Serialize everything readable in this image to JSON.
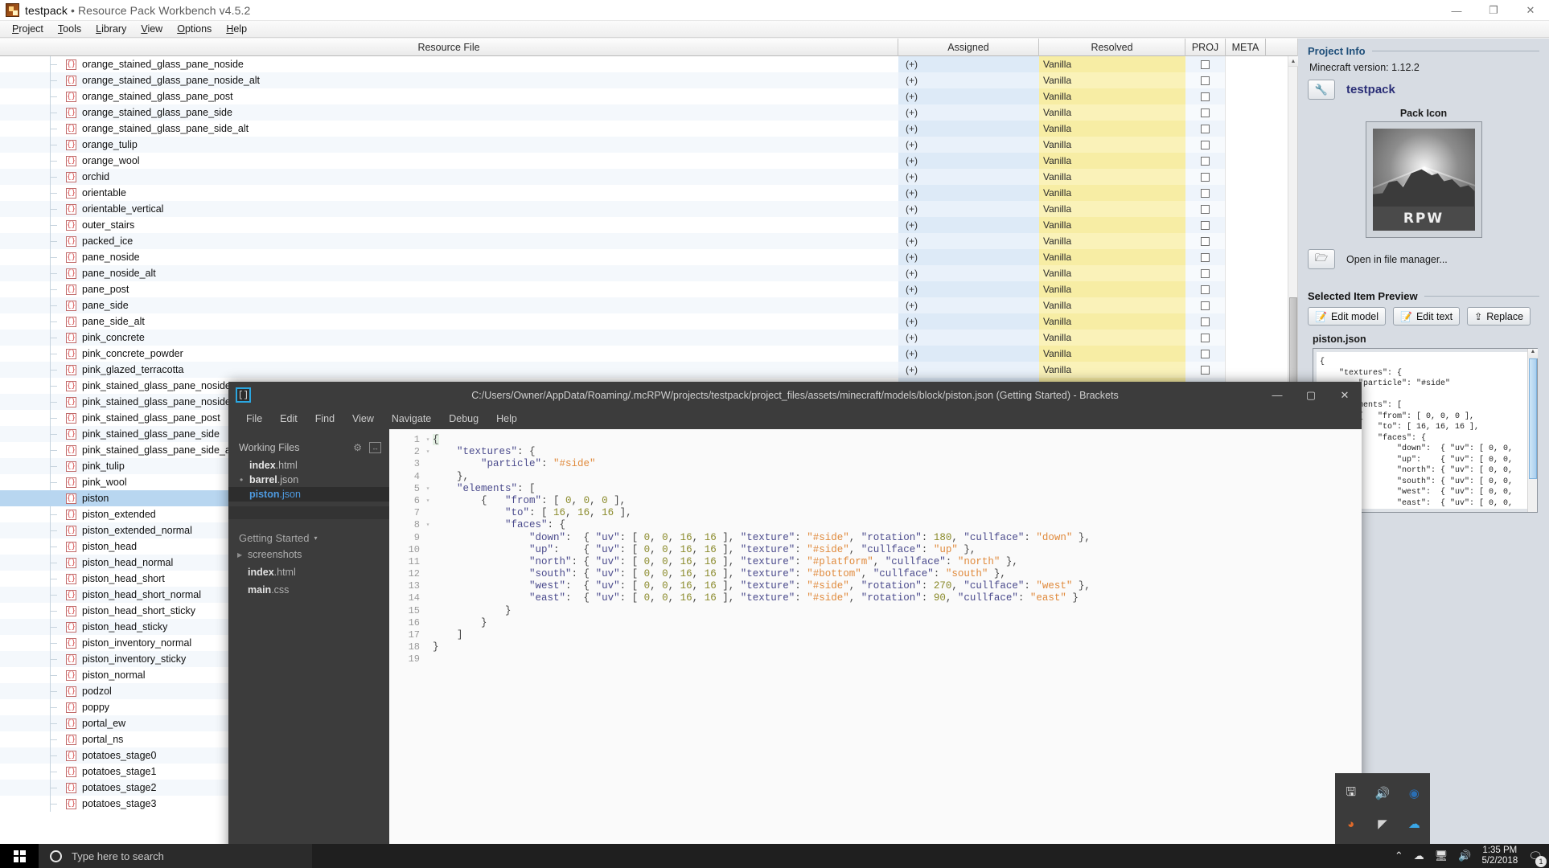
{
  "window": {
    "app_title_project": "testpack",
    "app_title_sep": "•",
    "app_title_app": "Resource Pack Workbench v4.5.2",
    "minimize": "—",
    "maximize": "❐",
    "close": "✕",
    "app_icon": "rpw-app-icon"
  },
  "menubar": [
    {
      "label": "Project"
    },
    {
      "label": "Tools"
    },
    {
      "label": "Library"
    },
    {
      "label": "View"
    },
    {
      "label": "Options"
    },
    {
      "label": "Help"
    }
  ],
  "table": {
    "columns": [
      "Resource File",
      "Assigned",
      "Resolved",
      "PROJ",
      "META"
    ],
    "assigned_value": "(+)",
    "resolved_value": "Vanilla",
    "rows": [
      "orange_stained_glass_pane_noside",
      "orange_stained_glass_pane_noside_alt",
      "orange_stained_glass_pane_post",
      "orange_stained_glass_pane_side",
      "orange_stained_glass_pane_side_alt",
      "orange_tulip",
      "orange_wool",
      "orchid",
      "orientable",
      "orientable_vertical",
      "outer_stairs",
      "packed_ice",
      "pane_noside",
      "pane_noside_alt",
      "pane_post",
      "pane_side",
      "pane_side_alt",
      "pink_concrete",
      "pink_concrete_powder",
      "pink_glazed_terracotta",
      "pink_stained_glass_pane_noside",
      "pink_stained_glass_pane_noside_alt",
      "pink_stained_glass_pane_post",
      "pink_stained_glass_pane_side",
      "pink_stained_glass_pane_side_alt",
      "pink_tulip",
      "pink_wool",
      "piston",
      "piston_extended",
      "piston_extended_normal",
      "piston_head",
      "piston_head_normal",
      "piston_head_short",
      "piston_head_short_normal",
      "piston_head_short_sticky",
      "piston_head_sticky",
      "piston_inventory_normal",
      "piston_inventory_sticky",
      "piston_normal",
      "podzol",
      "poppy",
      "portal_ew",
      "portal_ns",
      "potatoes_stage0",
      "potatoes_stage1",
      "potatoes_stage2",
      "potatoes_stage3"
    ],
    "selected_row": "piston",
    "file_icon": "json-braces-icon"
  },
  "project_info": {
    "section_title": "Project Info",
    "minecraft_version": "Minecraft version: 1.12.2",
    "pack_name": "testpack",
    "edit_pack_icon": "wrench-icon",
    "pack_icon_label": "Pack Icon",
    "pack_icon_text": "RPW",
    "open_file_manager_icon": "folder-open-icon",
    "open_file_manager": "Open in file manager..."
  },
  "selected_item_preview": {
    "section_title": "Selected Item Preview",
    "buttons": [
      {
        "label": "Edit model",
        "icon": "pencil-note-icon"
      },
      {
        "label": "Edit text",
        "icon": "pencil-note-icon"
      },
      {
        "label": "Replace",
        "icon": "upload-icon"
      }
    ],
    "file_name": "piston.json",
    "preview_lines": [
      "{",
      "    \"textures\": {",
      "        \"particle\": \"#side\"",
      "    },",
      "    \"elements\": [",
      "        {   \"from\": [ 0, 0, 0 ],",
      "            \"to\": [ 16, 16, 16 ],",
      "            \"faces\": {",
      "                \"down\":  { \"uv\": [ 0, 0,",
      "                \"up\":    { \"uv\": [ 0, 0,",
      "                \"north\": { \"uv\": [ 0, 0,",
      "                \"south\": { \"uv\": [ 0, 0,",
      "                \"west\":  { \"uv\": [ 0, 0,",
      "                \"east\":  { \"uv\": [ 0, 0,"
    ]
  },
  "brackets": {
    "app_icon": "brackets-logo-icon",
    "title": "C:/Users/Owner/AppData/Roaming/.mcRPW/projects/testpack/project_files/assets/minecraft/models/block/piston.json (Getting Started) - Brackets",
    "minimize": "—",
    "maximize": "▢",
    "close": "✕",
    "menu": [
      "File",
      "Edit",
      "Find",
      "View",
      "Navigate",
      "Debug",
      "Help"
    ],
    "working_files_label": "Working Files",
    "gear_icon": "gear-icon",
    "split_icon": "split-view-icon",
    "working_files": [
      {
        "name": "index",
        "ext": ".html",
        "dirty": false,
        "active": false
      },
      {
        "name": "barrel",
        "ext": ".json",
        "dirty": true,
        "active": false
      },
      {
        "name": "piston",
        "ext": ".json",
        "dirty": false,
        "active": true
      }
    ],
    "project_label": "Getting Started",
    "project_caret": "▾",
    "tree": [
      {
        "name": "screenshots",
        "ext": "",
        "folder": true
      },
      {
        "name": "index",
        "ext": ".html",
        "folder": false
      },
      {
        "name": "main",
        "ext": ".css",
        "folder": false
      }
    ],
    "code_lines": [
      {
        "num": "1",
        "fold": "▾",
        "tokens": [
          {
            "t": "{",
            "c": "p"
          }
        ]
      },
      {
        "num": "2",
        "fold": "▾",
        "tokens": [
          {
            "t": "    ",
            "c": "p"
          },
          {
            "t": "\"textures\"",
            "c": "k"
          },
          {
            "t": ": {",
            "c": "p"
          }
        ]
      },
      {
        "num": "3",
        "fold": "",
        "tokens": [
          {
            "t": "        ",
            "c": "p"
          },
          {
            "t": "\"particle\"",
            "c": "k"
          },
          {
            "t": ": ",
            "c": "p"
          },
          {
            "t": "\"#side\"",
            "c": "s"
          }
        ]
      },
      {
        "num": "4",
        "fold": "",
        "tokens": [
          {
            "t": "    },",
            "c": "p"
          }
        ]
      },
      {
        "num": "5",
        "fold": "▾",
        "tokens": [
          {
            "t": "    ",
            "c": "p"
          },
          {
            "t": "\"elements\"",
            "c": "k"
          },
          {
            "t": ": [",
            "c": "p"
          }
        ]
      },
      {
        "num": "6",
        "fold": "▾",
        "tokens": [
          {
            "t": "        {   ",
            "c": "p"
          },
          {
            "t": "\"from\"",
            "c": "k"
          },
          {
            "t": ": [ ",
            "c": "p"
          },
          {
            "t": "0",
            "c": "n"
          },
          {
            "t": ", ",
            "c": "p"
          },
          {
            "t": "0",
            "c": "n"
          },
          {
            "t": ", ",
            "c": "p"
          },
          {
            "t": "0",
            "c": "n"
          },
          {
            "t": " ],",
            "c": "p"
          }
        ]
      },
      {
        "num": "7",
        "fold": "",
        "tokens": [
          {
            "t": "            ",
            "c": "p"
          },
          {
            "t": "\"to\"",
            "c": "k"
          },
          {
            "t": ": [ ",
            "c": "p"
          },
          {
            "t": "16",
            "c": "n"
          },
          {
            "t": ", ",
            "c": "p"
          },
          {
            "t": "16",
            "c": "n"
          },
          {
            "t": ", ",
            "c": "p"
          },
          {
            "t": "16",
            "c": "n"
          },
          {
            "t": " ],",
            "c": "p"
          }
        ]
      },
      {
        "num": "8",
        "fold": "▾",
        "tokens": [
          {
            "t": "            ",
            "c": "p"
          },
          {
            "t": "\"faces\"",
            "c": "k"
          },
          {
            "t": ": {",
            "c": "p"
          }
        ]
      },
      {
        "num": "9",
        "fold": "",
        "tokens": [
          {
            "t": "                ",
            "c": "p"
          },
          {
            "t": "\"down\"",
            "c": "k"
          },
          {
            "t": ":  { ",
            "c": "p"
          },
          {
            "t": "\"uv\"",
            "c": "k"
          },
          {
            "t": ": [ ",
            "c": "p"
          },
          {
            "t": "0",
            "c": "n"
          },
          {
            "t": ", ",
            "c": "p"
          },
          {
            "t": "0",
            "c": "n"
          },
          {
            "t": ", ",
            "c": "p"
          },
          {
            "t": "16",
            "c": "n"
          },
          {
            "t": ", ",
            "c": "p"
          },
          {
            "t": "16",
            "c": "n"
          },
          {
            "t": " ], ",
            "c": "p"
          },
          {
            "t": "\"texture\"",
            "c": "k"
          },
          {
            "t": ": ",
            "c": "p"
          },
          {
            "t": "\"#side\"",
            "c": "s"
          },
          {
            "t": ", ",
            "c": "p"
          },
          {
            "t": "\"rotation\"",
            "c": "k"
          },
          {
            "t": ": ",
            "c": "p"
          },
          {
            "t": "180",
            "c": "n"
          },
          {
            "t": ", ",
            "c": "p"
          },
          {
            "t": "\"cullface\"",
            "c": "k"
          },
          {
            "t": ": ",
            "c": "p"
          },
          {
            "t": "\"down\"",
            "c": "s"
          },
          {
            "t": " },",
            "c": "p"
          }
        ]
      },
      {
        "num": "10",
        "fold": "",
        "tokens": [
          {
            "t": "                ",
            "c": "p"
          },
          {
            "t": "\"up\"",
            "c": "k"
          },
          {
            "t": ":    { ",
            "c": "p"
          },
          {
            "t": "\"uv\"",
            "c": "k"
          },
          {
            "t": ": [ ",
            "c": "p"
          },
          {
            "t": "0",
            "c": "n"
          },
          {
            "t": ", ",
            "c": "p"
          },
          {
            "t": "0",
            "c": "n"
          },
          {
            "t": ", ",
            "c": "p"
          },
          {
            "t": "16",
            "c": "n"
          },
          {
            "t": ", ",
            "c": "p"
          },
          {
            "t": "16",
            "c": "n"
          },
          {
            "t": " ], ",
            "c": "p"
          },
          {
            "t": "\"texture\"",
            "c": "k"
          },
          {
            "t": ": ",
            "c": "p"
          },
          {
            "t": "\"#side\"",
            "c": "s"
          },
          {
            "t": ", ",
            "c": "p"
          },
          {
            "t": "\"cullface\"",
            "c": "k"
          },
          {
            "t": ": ",
            "c": "p"
          },
          {
            "t": "\"up\"",
            "c": "s"
          },
          {
            "t": " },",
            "c": "p"
          }
        ]
      },
      {
        "num": "11",
        "fold": "",
        "tokens": [
          {
            "t": "                ",
            "c": "p"
          },
          {
            "t": "\"north\"",
            "c": "k"
          },
          {
            "t": ": { ",
            "c": "p"
          },
          {
            "t": "\"uv\"",
            "c": "k"
          },
          {
            "t": ": [ ",
            "c": "p"
          },
          {
            "t": "0",
            "c": "n"
          },
          {
            "t": ", ",
            "c": "p"
          },
          {
            "t": "0",
            "c": "n"
          },
          {
            "t": ", ",
            "c": "p"
          },
          {
            "t": "16",
            "c": "n"
          },
          {
            "t": ", ",
            "c": "p"
          },
          {
            "t": "16",
            "c": "n"
          },
          {
            "t": " ], ",
            "c": "p"
          },
          {
            "t": "\"texture\"",
            "c": "k"
          },
          {
            "t": ": ",
            "c": "p"
          },
          {
            "t": "\"#platform\"",
            "c": "s"
          },
          {
            "t": ", ",
            "c": "p"
          },
          {
            "t": "\"cullface\"",
            "c": "k"
          },
          {
            "t": ": ",
            "c": "p"
          },
          {
            "t": "\"north\"",
            "c": "s"
          },
          {
            "t": " },",
            "c": "p"
          }
        ]
      },
      {
        "num": "12",
        "fold": "",
        "tokens": [
          {
            "t": "                ",
            "c": "p"
          },
          {
            "t": "\"south\"",
            "c": "k"
          },
          {
            "t": ": { ",
            "c": "p"
          },
          {
            "t": "\"uv\"",
            "c": "k"
          },
          {
            "t": ": [ ",
            "c": "p"
          },
          {
            "t": "0",
            "c": "n"
          },
          {
            "t": ", ",
            "c": "p"
          },
          {
            "t": "0",
            "c": "n"
          },
          {
            "t": ", ",
            "c": "p"
          },
          {
            "t": "16",
            "c": "n"
          },
          {
            "t": ", ",
            "c": "p"
          },
          {
            "t": "16",
            "c": "n"
          },
          {
            "t": " ], ",
            "c": "p"
          },
          {
            "t": "\"texture\"",
            "c": "k"
          },
          {
            "t": ": ",
            "c": "p"
          },
          {
            "t": "\"#bottom\"",
            "c": "s"
          },
          {
            "t": ", ",
            "c": "p"
          },
          {
            "t": "\"cullface\"",
            "c": "k"
          },
          {
            "t": ": ",
            "c": "p"
          },
          {
            "t": "\"south\"",
            "c": "s"
          },
          {
            "t": " },",
            "c": "p"
          }
        ]
      },
      {
        "num": "13",
        "fold": "",
        "tokens": [
          {
            "t": "                ",
            "c": "p"
          },
          {
            "t": "\"west\"",
            "c": "k"
          },
          {
            "t": ":  { ",
            "c": "p"
          },
          {
            "t": "\"uv\"",
            "c": "k"
          },
          {
            "t": ": [ ",
            "c": "p"
          },
          {
            "t": "0",
            "c": "n"
          },
          {
            "t": ", ",
            "c": "p"
          },
          {
            "t": "0",
            "c": "n"
          },
          {
            "t": ", ",
            "c": "p"
          },
          {
            "t": "16",
            "c": "n"
          },
          {
            "t": ", ",
            "c": "p"
          },
          {
            "t": "16",
            "c": "n"
          },
          {
            "t": " ], ",
            "c": "p"
          },
          {
            "t": "\"texture\"",
            "c": "k"
          },
          {
            "t": ": ",
            "c": "p"
          },
          {
            "t": "\"#side\"",
            "c": "s"
          },
          {
            "t": ", ",
            "c": "p"
          },
          {
            "t": "\"rotation\"",
            "c": "k"
          },
          {
            "t": ": ",
            "c": "p"
          },
          {
            "t": "270",
            "c": "n"
          },
          {
            "t": ", ",
            "c": "p"
          },
          {
            "t": "\"cullface\"",
            "c": "k"
          },
          {
            "t": ": ",
            "c": "p"
          },
          {
            "t": "\"west\"",
            "c": "s"
          },
          {
            "t": " },",
            "c": "p"
          }
        ]
      },
      {
        "num": "14",
        "fold": "",
        "tokens": [
          {
            "t": "                ",
            "c": "p"
          },
          {
            "t": "\"east\"",
            "c": "k"
          },
          {
            "t": ":  { ",
            "c": "p"
          },
          {
            "t": "\"uv\"",
            "c": "k"
          },
          {
            "t": ": [ ",
            "c": "p"
          },
          {
            "t": "0",
            "c": "n"
          },
          {
            "t": ", ",
            "c": "p"
          },
          {
            "t": "0",
            "c": "n"
          },
          {
            "t": ", ",
            "c": "p"
          },
          {
            "t": "16",
            "c": "n"
          },
          {
            "t": ", ",
            "c": "p"
          },
          {
            "t": "16",
            "c": "n"
          },
          {
            "t": " ], ",
            "c": "p"
          },
          {
            "t": "\"texture\"",
            "c": "k"
          },
          {
            "t": ": ",
            "c": "p"
          },
          {
            "t": "\"#side\"",
            "c": "s"
          },
          {
            "t": ", ",
            "c": "p"
          },
          {
            "t": "\"rotation\"",
            "c": "k"
          },
          {
            "t": ": ",
            "c": "p"
          },
          {
            "t": "90",
            "c": "n"
          },
          {
            "t": ", ",
            "c": "p"
          },
          {
            "t": "\"cullface\"",
            "c": "k"
          },
          {
            "t": ": ",
            "c": "p"
          },
          {
            "t": "\"east\"",
            "c": "s"
          },
          {
            "t": " }",
            "c": "p"
          }
        ]
      },
      {
        "num": "15",
        "fold": "",
        "tokens": [
          {
            "t": "            }",
            "c": "p"
          }
        ]
      },
      {
        "num": "16",
        "fold": "",
        "tokens": [
          {
            "t": "        }",
            "c": "p"
          }
        ]
      },
      {
        "num": "17",
        "fold": "",
        "tokens": [
          {
            "t": "    ]",
            "c": "p"
          }
        ]
      },
      {
        "num": "18",
        "fold": "",
        "tokens": [
          {
            "t": "}",
            "c": "p"
          }
        ]
      },
      {
        "num": "19",
        "fold": "",
        "tokens": [
          {
            "t": "",
            "c": "p"
          }
        ]
      }
    ]
  },
  "taskbar": {
    "start_icon": "windows-logo-icon",
    "cortana_icon": "cortana-circle-icon",
    "search_placeholder": "Type here to search",
    "tray_expand_icon": "chevron-up-icon",
    "tray_icons": [
      "onedrive-icon",
      "network-icon",
      "volume-icon"
    ],
    "time": "1:35 PM",
    "date": "5/2/2018",
    "notification_icon": "notification-icon",
    "notification_count": "1",
    "tray_popup_icons": [
      "usb-safely-remove-icon",
      "volume-mute-icon",
      "steam-icon",
      "ghost-icon",
      "gyazo-icon",
      "onedrive-cloud-icon"
    ]
  }
}
